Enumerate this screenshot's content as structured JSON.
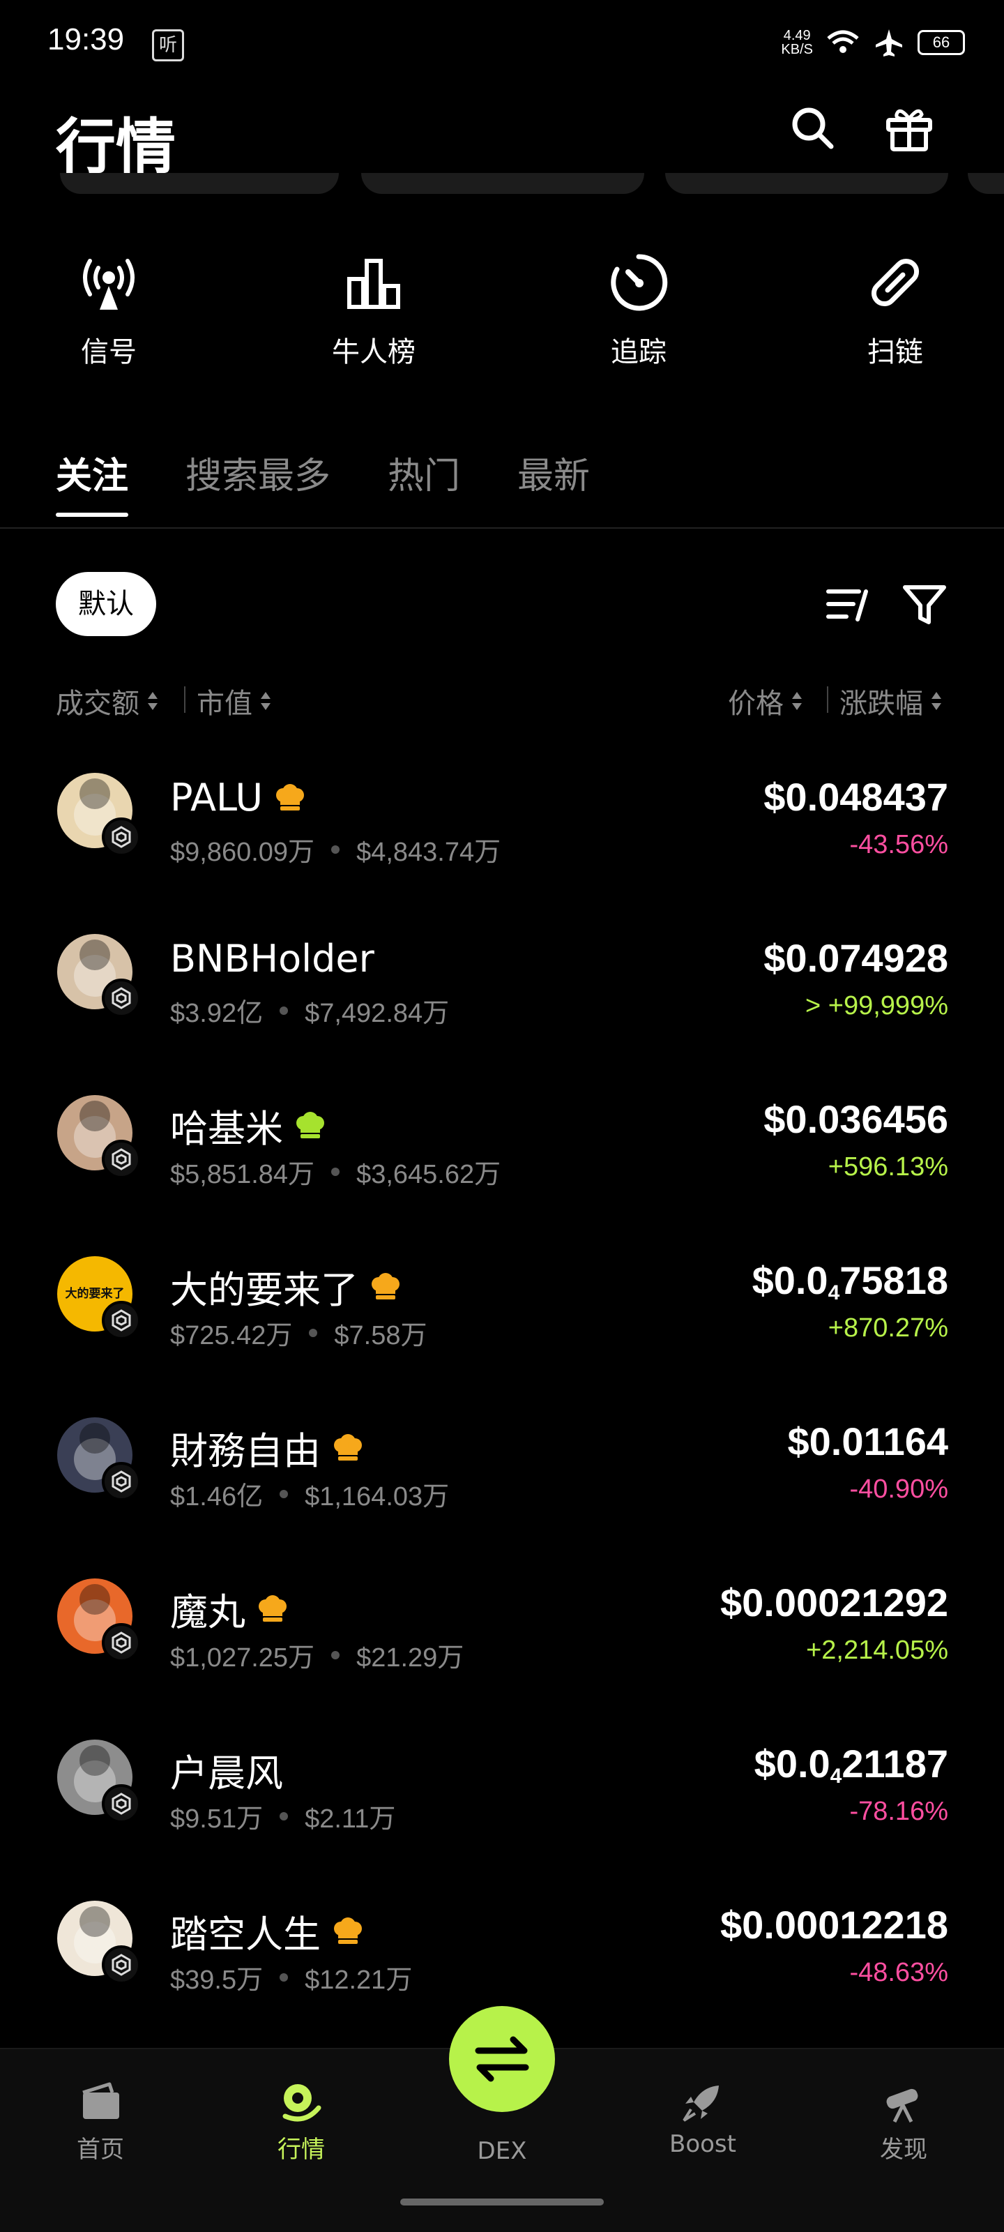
{
  "status_bar": {
    "time": "19:39",
    "app_icon_text": "听",
    "net_speed_value": "4.49",
    "net_speed_unit": "KB/S",
    "battery": "66"
  },
  "header": {
    "title": "行情",
    "search_icon": "search-icon",
    "gift_icon": "gift-icon"
  },
  "quick_actions": [
    {
      "label": "信号",
      "icon": "broadcast-icon"
    },
    {
      "label": "牛人榜",
      "icon": "leaderboard-icon"
    },
    {
      "label": "追踪",
      "icon": "tracking-icon"
    },
    {
      "label": "扫链",
      "icon": "link-icon"
    }
  ],
  "tabs": [
    {
      "label": "关注",
      "active": true
    },
    {
      "label": "搜索最多",
      "active": false
    },
    {
      "label": "热门",
      "active": false
    },
    {
      "label": "最新",
      "active": false
    }
  ],
  "filter": {
    "chip_label": "默认",
    "sort_icon": "sort-icon",
    "filter_icon": "filter-icon"
  },
  "sort_headers": {
    "volume": "成交额",
    "market_cap": "市值",
    "price": "价格",
    "change": "涨跌幅"
  },
  "tokens": [
    {
      "name": "PALU",
      "crown": true,
      "crown_color": "#f6a81b",
      "volume": "$9,860.09万",
      "market_cap": "$4,843.74万",
      "price": "$0.048437",
      "change": "-43.56%",
      "direction": "down",
      "avatar_color": "#e9d6b0"
    },
    {
      "name": "BNBHolder",
      "crown": false,
      "volume": "$3.92亿",
      "market_cap": "$7,492.84万",
      "price": "$0.074928",
      "change": "> +99,999%",
      "direction": "up",
      "avatar_color": "#d7c2a8"
    },
    {
      "name": "哈基米",
      "crown": true,
      "crown_color": "#a6e22e",
      "volume": "$5,851.84万",
      "market_cap": "$3,645.62万",
      "price": "$0.036456",
      "change": "+596.13%",
      "direction": "up",
      "avatar_color": "#c7a488"
    },
    {
      "name": "大的要来了",
      "crown": true,
      "crown_color": "#f6a81b",
      "volume": "$725.42万",
      "market_cap": "$7.58万",
      "price_prefix": "$0.0",
      "price_sub": "4",
      "price_suffix": "75818",
      "change": "+870.27%",
      "direction": "up",
      "avatar_color": "#f5b800",
      "avatar_text": "大的要来了"
    },
    {
      "name": "財務自由",
      "crown": true,
      "crown_color": "#f6a81b",
      "volume": "$1.46亿",
      "market_cap": "$1,164.03万",
      "price": "$0.01164",
      "change": "-40.90%",
      "direction": "down",
      "avatar_color": "#3a3f55"
    },
    {
      "name": "魔丸",
      "crown": true,
      "crown_color": "#f6a81b",
      "volume": "$1,027.25万",
      "market_cap": "$21.29万",
      "price": "$0.00021292",
      "change": "+2,214.05%",
      "direction": "up",
      "avatar_color": "#e8682a"
    },
    {
      "name": "户晨风",
      "crown": false,
      "volume": "$9.51万",
      "market_cap": "$2.11万",
      "price_prefix": "$0.0",
      "price_sub": "4",
      "price_suffix": "21187",
      "change": "-78.16%",
      "direction": "down",
      "avatar_color": "#8d8d8d"
    },
    {
      "name": "踏空人生",
      "crown": true,
      "crown_color": "#f6a81b",
      "volume": "$39.5万",
      "market_cap": "$12.21万",
      "price": "$0.00012218",
      "change": "-48.63%",
      "direction": "down",
      "avatar_color": "#efe6d8"
    }
  ],
  "bottom_nav": [
    {
      "label": "首页",
      "icon": "wallet-icon",
      "active": false
    },
    {
      "label": "行情",
      "icon": "market-icon",
      "active": true
    },
    {
      "label": "DEX",
      "icon": "swap-icon",
      "active": false
    },
    {
      "label": "Boost",
      "icon": "rocket-icon",
      "active": false
    },
    {
      "label": "发现",
      "icon": "telescope-icon",
      "active": false
    }
  ],
  "colors": {
    "accent": "#b7f24a",
    "negative": "#ff4fa1",
    "positive": "#b7f24a",
    "muted": "#8a8a8a"
  }
}
